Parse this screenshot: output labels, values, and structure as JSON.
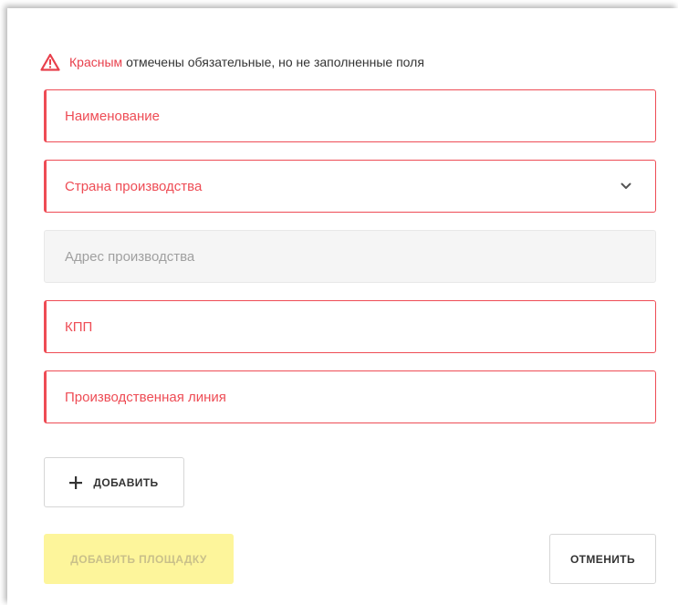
{
  "notice": {
    "icon": "warning-triangle-icon",
    "accent_word": "Красным",
    "text": "отмечены обязательные, но не заполненные поля",
    "accent_color": "#e8404c"
  },
  "fields": {
    "name": {
      "placeholder": "Наименование",
      "state": "required-empty"
    },
    "country": {
      "placeholder": "Страна производства",
      "state": "required-empty",
      "icon": "chevron-down-icon"
    },
    "address": {
      "placeholder": "Адрес производства",
      "state": "disabled"
    },
    "kpp": {
      "placeholder": "КПП",
      "state": "required-empty"
    },
    "line": {
      "placeholder": "Производственная линия",
      "state": "required-empty"
    }
  },
  "buttons": {
    "add": {
      "label": "ДОБАВИТЬ",
      "icon": "plus-icon"
    },
    "add_site": {
      "label": "ДОБАВИТЬ ПЛОЩАДКУ",
      "state": "disabled"
    },
    "cancel": {
      "label": "ОТМЕНИТЬ"
    }
  },
  "colors": {
    "error": "#ee4c55",
    "disabled_bg": "#f5f5f5",
    "primary_disabled": "#fdf59b"
  }
}
